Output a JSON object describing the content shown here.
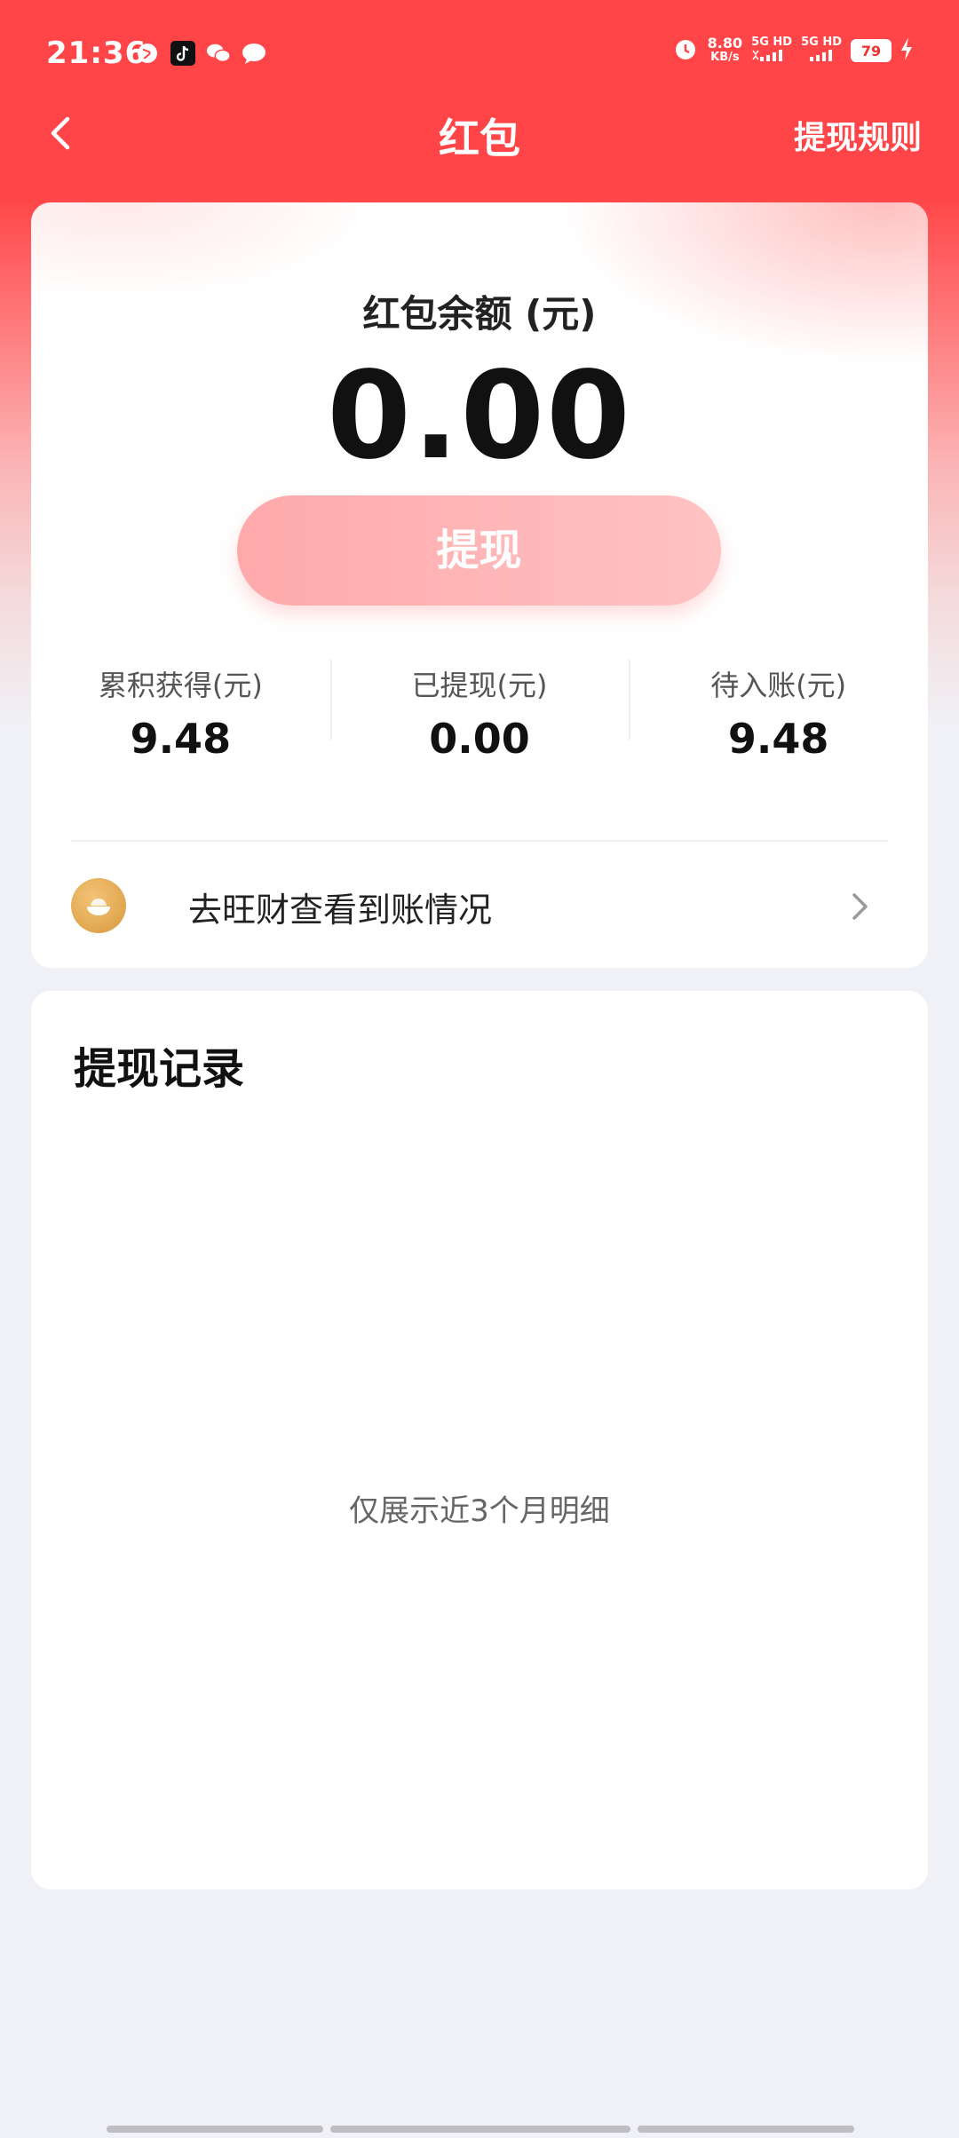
{
  "status_bar": {
    "time": "21:36",
    "net_speed": "8.80",
    "net_speed_unit": "KB/s",
    "sim1": "5G HD",
    "sim2": "5G HD",
    "battery": "79"
  },
  "nav": {
    "title": "红包",
    "rule_link": "提现规则"
  },
  "balance": {
    "label": "红包余额 (元)",
    "amount": "0.00",
    "withdraw_button": "提现"
  },
  "stats": [
    {
      "label": "累积获得(元)",
      "value": "9.48"
    },
    {
      "label": "已提现(元)",
      "value": "0.00"
    },
    {
      "label": "待入账(元)",
      "value": "9.48"
    }
  ],
  "link_row": {
    "text": "去旺财查看到账情况"
  },
  "records": {
    "title": "提现记录",
    "hint": "仅展示近3个月明细"
  },
  "colors": {
    "brand_red": "#ff4547",
    "button_pink": "#ffb0b2",
    "background": "#f0f1f6"
  }
}
